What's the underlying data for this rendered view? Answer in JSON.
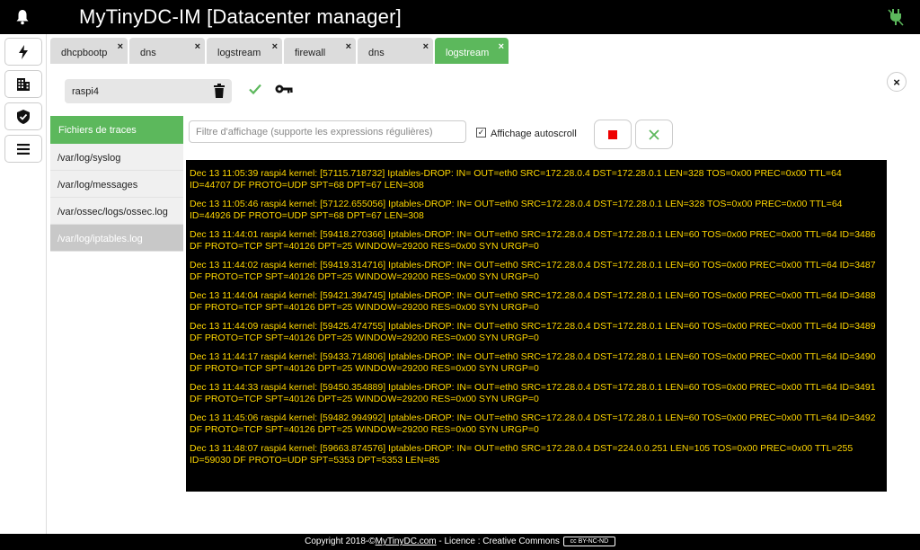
{
  "app": {
    "title": "MyTinyDC-IM [Datacenter manager]"
  },
  "tabs": [
    {
      "label": "dhcpbootp",
      "close": "×"
    },
    {
      "label": "dns",
      "close": "×"
    },
    {
      "label": "logstream",
      "close": "×"
    },
    {
      "label": "firewall",
      "close": "×"
    },
    {
      "label": "dns",
      "close": "×"
    },
    {
      "label": "logstream",
      "close": "×",
      "active": true
    }
  ],
  "host": {
    "value": "raspi4"
  },
  "files": {
    "header": "Fichiers de traces",
    "items": [
      "/var/log/syslog",
      "/var/log/messages",
      "/var/ossec/logs/ossec.log",
      "/var/log/iptables.log"
    ],
    "selected_index": 3
  },
  "filter": {
    "placeholder": "Filtre d'affichage (supporte les expressions régulières)"
  },
  "autoscroll": {
    "label": "Affichage autoscroll",
    "checked": true,
    "mark": "✓"
  },
  "close_button": "×",
  "colors": {
    "accent_green": "#5cb85c",
    "log_text": "#ffd700",
    "stop_red": "#e00000"
  },
  "log_lines": [
    "Dec 13 11:05:39 raspi4 kernel: [57115.718732] Iptables-DROP: IN= OUT=eth0 SRC=172.28.0.4 DST=172.28.0.1 LEN=328 TOS=0x00 PREC=0x00 TTL=64 ID=44707 DF PROTO=UDP SPT=68 DPT=67 LEN=308",
    "Dec 13 11:05:46 raspi4 kernel: [57122.655056] Iptables-DROP: IN= OUT=eth0 SRC=172.28.0.4 DST=172.28.0.1 LEN=328 TOS=0x00 PREC=0x00 TTL=64 ID=44926 DF PROTO=UDP SPT=68 DPT=67 LEN=308",
    "Dec 13 11:44:01 raspi4 kernel: [59418.270366] Iptables-DROP: IN= OUT=eth0 SRC=172.28.0.4 DST=172.28.0.1 LEN=60 TOS=0x00 PREC=0x00 TTL=64 ID=3486 DF PROTO=TCP SPT=40126 DPT=25 WINDOW=29200 RES=0x00 SYN URGP=0",
    "Dec 13 11:44:02 raspi4 kernel: [59419.314716] Iptables-DROP: IN= OUT=eth0 SRC=172.28.0.4 DST=172.28.0.1 LEN=60 TOS=0x00 PREC=0x00 TTL=64 ID=3487 DF PROTO=TCP SPT=40126 DPT=25 WINDOW=29200 RES=0x00 SYN URGP=0",
    "Dec 13 11:44:04 raspi4 kernel: [59421.394745] Iptables-DROP: IN= OUT=eth0 SRC=172.28.0.4 DST=172.28.0.1 LEN=60 TOS=0x00 PREC=0x00 TTL=64 ID=3488 DF PROTO=TCP SPT=40126 DPT=25 WINDOW=29200 RES=0x00 SYN URGP=0",
    "Dec 13 11:44:09 raspi4 kernel: [59425.474755] Iptables-DROP: IN= OUT=eth0 SRC=172.28.0.4 DST=172.28.0.1 LEN=60 TOS=0x00 PREC=0x00 TTL=64 ID=3489 DF PROTO=TCP SPT=40126 DPT=25 WINDOW=29200 RES=0x00 SYN URGP=0",
    "Dec 13 11:44:17 raspi4 kernel: [59433.714806] Iptables-DROP: IN= OUT=eth0 SRC=172.28.0.4 DST=172.28.0.1 LEN=60 TOS=0x00 PREC=0x00 TTL=64 ID=3490 DF PROTO=TCP SPT=40126 DPT=25 WINDOW=29200 RES=0x00 SYN URGP=0",
    "Dec 13 11:44:33 raspi4 kernel: [59450.354889] Iptables-DROP: IN= OUT=eth0 SRC=172.28.0.4 DST=172.28.0.1 LEN=60 TOS=0x00 PREC=0x00 TTL=64 ID=3491 DF PROTO=TCP SPT=40126 DPT=25 WINDOW=29200 RES=0x00 SYN URGP=0",
    "Dec 13 11:45:06 raspi4 kernel: [59482.994992] Iptables-DROP: IN= OUT=eth0 SRC=172.28.0.4 DST=172.28.0.1 LEN=60 TOS=0x00 PREC=0x00 TTL=64 ID=3492 DF PROTO=TCP SPT=40126 DPT=25 WINDOW=29200 RES=0x00 SYN URGP=0",
    "Dec 13 11:48:07 raspi4 kernel: [59663.874576] Iptables-DROP: IN= OUT=eth0 SRC=172.28.0.4 DST=224.0.0.251 LEN=105 TOS=0x00 PREC=0x00 TTL=255 ID=59030 DF PROTO=UDP SPT=5353 DPT=5353 LEN=85"
  ],
  "footer": {
    "prefix": "Copyright 2018-©",
    "link": "MyTinyDC.com",
    "suffix": " - Licence : Creative Commons",
    "badge": "cc BY-NC-ND"
  },
  "icons": {
    "topbar_left": "bell-icon",
    "topbar_right": "plug-icon",
    "nav": [
      "lightning-icon",
      "building-icon",
      "shield-check-icon",
      "menu-icon"
    ]
  }
}
